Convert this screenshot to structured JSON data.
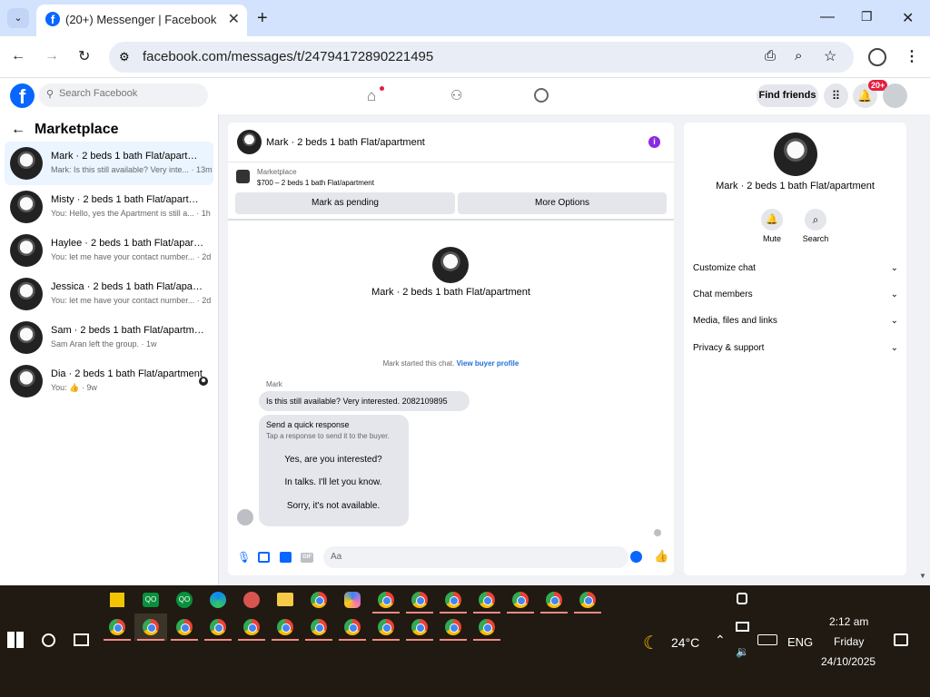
{
  "browser": {
    "tab_title": "(20+) Messenger | Facebook",
    "url": "facebook.com/messages/t/24794172890221495"
  },
  "fb_header": {
    "search_placeholder": "Search Facebook",
    "find_friends": "Find friends",
    "notification_badge": "20+"
  },
  "left_panel": {
    "title": "Marketplace",
    "conversations": [
      {
        "name": "Mark · 2 beds 1 bath Flat/apartment",
        "preview": "Mark: Is this still available? Very inte... · 13m"
      },
      {
        "name": "Misty · 2 beds 1 bath Flat/apartment",
        "preview": "You: Hello, yes the Apartment is still a... · 1h"
      },
      {
        "name": "Haylee · 2 beds 1 bath Flat/apartm...",
        "preview": "You: let me have your contact number... · 2d"
      },
      {
        "name": "Jessica · 2 beds 1 bath Flat/apartm...",
        "preview": "You: let me have your contact number... · 2d"
      },
      {
        "name": "Sam · 2 beds 1 bath Flat/apartment",
        "preview": "Sam Aran left the group. · 1w"
      },
      {
        "name": "Dia · 2 beds 1 bath Flat/apartment",
        "preview": "You: 👍 · 9w"
      }
    ]
  },
  "chat": {
    "header_name": "Mark · 2 beds 1 bath Flat/apartment",
    "listing_label": "Marketplace",
    "listing_detail": "$700 – 2 beds 1 bath Flat/apartment",
    "mark_pending": "Mark as pending",
    "more_options": "More Options",
    "center_name": "Mark · 2 beds 1 bath Flat/apartment",
    "started_text": "Mark started this chat.",
    "view_buyer_profile": "View buyer profile",
    "sender_label": "Mark",
    "message": "Is this still available? Very interested. 2082109895",
    "quick_title": "Send a quick response",
    "quick_subtitle": "Tap a response to send it to the buyer.",
    "quick_responses": [
      "Yes, are you interested?",
      "In talks. I'll let you know.",
      "Sorry, it's not available."
    ],
    "composer_placeholder": "Aa",
    "gif_label": "GIF"
  },
  "right_panel": {
    "name": "Mark · 2 beds 1 bath Flat/apartment",
    "mute": "Mute",
    "search": "Search",
    "sections": [
      "Customize chat",
      "Chat members",
      "Media, files and links",
      "Privacy & support"
    ]
  },
  "taskbar": {
    "temperature": "24°C",
    "language": "ENG",
    "time": "2:12 am",
    "day": "Friday",
    "date": "24/10/2025"
  },
  "colors": {
    "fb_blue": "#0866ff",
    "active_conv_bg": "#ebf5ff",
    "info_purple": "#8a2be2",
    "taskbar_bg": "#201a12"
  }
}
